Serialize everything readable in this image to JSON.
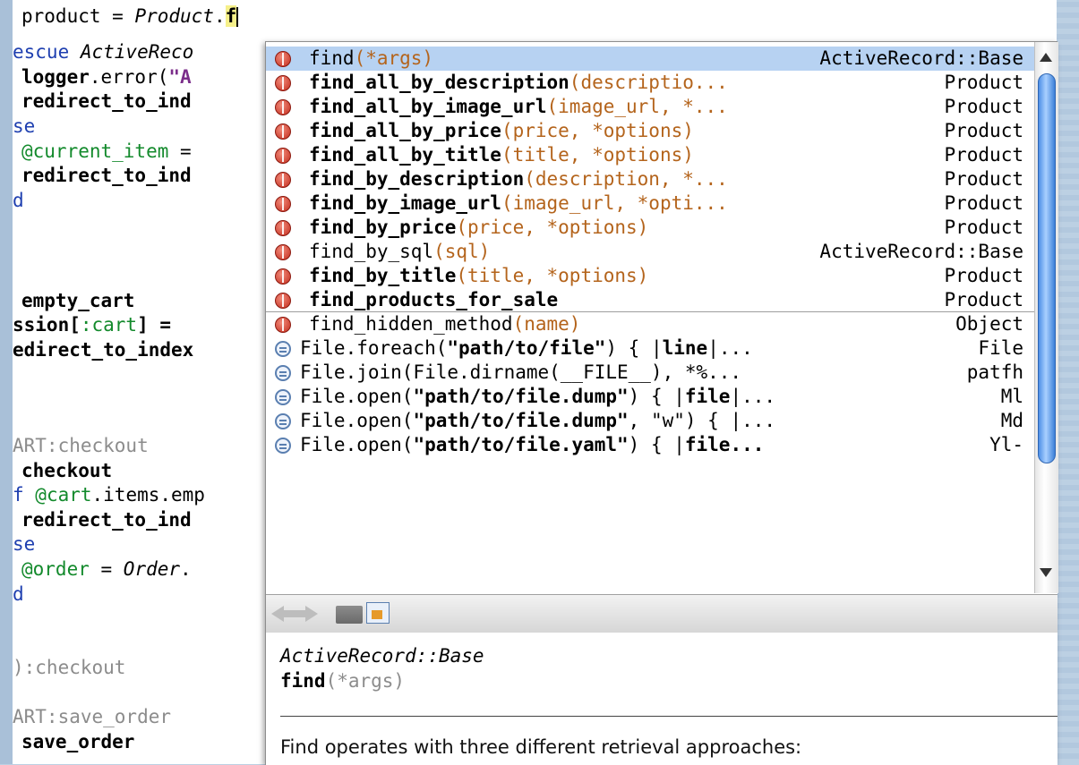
{
  "editor": {
    "lines": [
      {
        "top": 0
      },
      {
        "top": 0
      }
    ],
    "l0": {
      "a": "product = ",
      "b": "Product",
      "c": ".",
      "d": "f"
    },
    "l1": {
      "a": "escue ",
      "b": "ActiveReco"
    },
    "l2": {
      "a": "logger",
      "b": ".error(",
      "c": "\"A"
    },
    "l3": {
      "a": "redirect_to_ind"
    },
    "l4": {
      "a": "se"
    },
    "l5": {
      "a": "@current_item",
      "b": " ="
    },
    "l6": {
      "a": "redirect_to_ind"
    },
    "l7": {
      "a": "d"
    },
    "l8": {
      "a": "empty_cart"
    },
    "l9": {
      "a": "ssion[",
      "b": ":cart",
      "c": "] = "
    },
    "l10": {
      "a": "edirect_to_index"
    },
    "l11": {
      "a": "ART:checkout"
    },
    "l12": {
      "a": "checkout"
    },
    "l13": {
      "a": "f ",
      "b": "@cart",
      "c": ".items.emp"
    },
    "l14": {
      "a": "redirect_to_ind"
    },
    "l15": {
      "a": "se"
    },
    "l16": {
      "a": "@order",
      "b": " = ",
      "c": "Order",
      "d": "."
    },
    "l17": {
      "a": "d"
    },
    "l18": {
      "a": "):checkout"
    },
    "l19": {
      "a": "ART:save_order"
    },
    "l20": {
      "a": "save_order"
    }
  },
  "completion": {
    "items": [
      {
        "name": "find",
        "args": "(*args)",
        "cls": "ActiveRecord::Base",
        "bold": false,
        "kind": "method"
      },
      {
        "name": "find_all_by_description",
        "args": "(descriptio...",
        "cls": "Product",
        "bold": true,
        "kind": "method"
      },
      {
        "name": "find_all_by_image_url",
        "args": "(image_url, *...",
        "cls": "Product",
        "bold": true,
        "kind": "method"
      },
      {
        "name": "find_all_by_price",
        "args": "(price, *options)",
        "cls": "Product",
        "bold": true,
        "kind": "method"
      },
      {
        "name": "find_all_by_title",
        "args": "(title, *options)",
        "cls": "Product",
        "bold": true,
        "kind": "method"
      },
      {
        "name": "find_by_description",
        "args": "(description, *...",
        "cls": "Product",
        "bold": true,
        "kind": "method"
      },
      {
        "name": "find_by_image_url",
        "args": "(image_url, *opti...",
        "cls": "Product",
        "bold": true,
        "kind": "method"
      },
      {
        "name": "find_by_price",
        "args": "(price, *options)",
        "cls": "Product",
        "bold": true,
        "kind": "method"
      },
      {
        "name": "find_by_sql",
        "args": "(sql)",
        "cls": "ActiveRecord::Base",
        "bold": false,
        "kind": "method"
      },
      {
        "name": "find_by_title",
        "args": "(title, *options)",
        "cls": "Product",
        "bold": true,
        "kind": "method"
      },
      {
        "name": "find_products_for_sale",
        "args": "",
        "cls": "Product",
        "bold": true,
        "kind": "method"
      },
      {
        "name": "find_hidden_method",
        "args": "(name)",
        "cls": "Object",
        "bold": false,
        "kind": "method"
      }
    ],
    "snippets": [
      {
        "p1": "File.foreach(",
        "p2": "\"path/to/file\"",
        "p3": ") { |",
        "p4": "line",
        "p5": "|...",
        "cls": "File"
      },
      {
        "p1": "File.join(File.dirname(__FILE__), *%...",
        "p2": "",
        "p3": "",
        "p4": "",
        "p5": "",
        "cls": "patfh"
      },
      {
        "p1": "File.open(",
        "p2": "\"path/to/file.dump\"",
        "p3": ") { |",
        "p4": "file",
        "p5": "|...",
        "cls": "Ml"
      },
      {
        "p1": "File.open(",
        "p2": "\"path/to/file.dump\"",
        "p3": ", \"w\") { |...",
        "p4": "",
        "p5": "",
        "cls": "Md"
      },
      {
        "p1": "File.open(",
        "p2": "\"path/to/file.yaml\"",
        "p3": ") { |",
        "p4": "file...",
        "p5": "",
        "cls": "Yl-"
      }
    ]
  },
  "doc": {
    "cls": "ActiveRecord::Base",
    "sig_name": "find",
    "sig_args": "(*args)",
    "text": "Find operates with three different retrieval approaches:"
  }
}
